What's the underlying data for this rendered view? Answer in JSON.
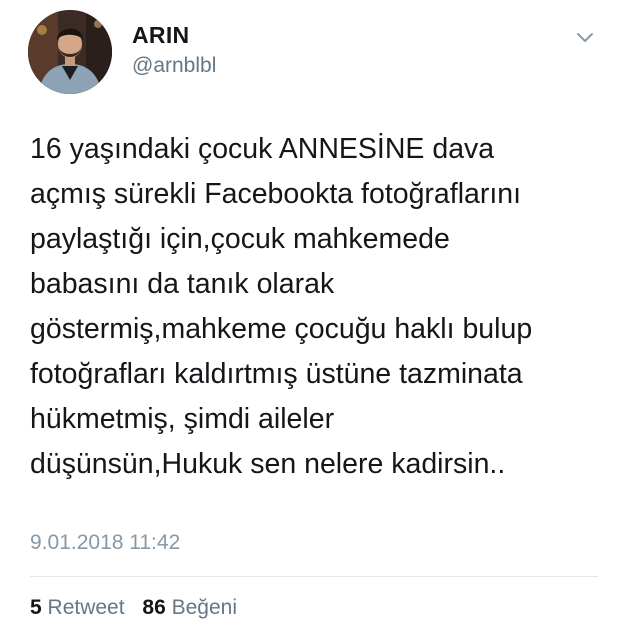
{
  "author": {
    "name": "ARIN",
    "handle": "@arnblbl"
  },
  "tweet": {
    "lines": [
      "16 yaşındaki çocuk ANNESİNE dava",
      "açmış sürekli Facebookta fotoğraflarını",
      "paylaştığı için,çocuk mahkemede",
      "babasını da tanık olarak",
      "göstermiş,mahkeme çocuğu haklı bulup",
      "fotoğrafları kaldırtmış üstüne tazminata",
      "hükmetmiş, şimdi aileler",
      "düşünsün,Hukuk sen nelere kadirsin.."
    ],
    "timestamp": "9.01.2018 11:42"
  },
  "stats": {
    "retweet_count": "5",
    "retweet_label": "Retweet",
    "like_count": "86",
    "like_label": "Beğeni"
  },
  "icons": {
    "menu": "chevron-down-icon",
    "avatar": "profile-photo"
  },
  "colors": {
    "text": "#14171a",
    "secondary": "#657786",
    "timestamp": "#8899a6",
    "divider": "#e1e8ed"
  }
}
